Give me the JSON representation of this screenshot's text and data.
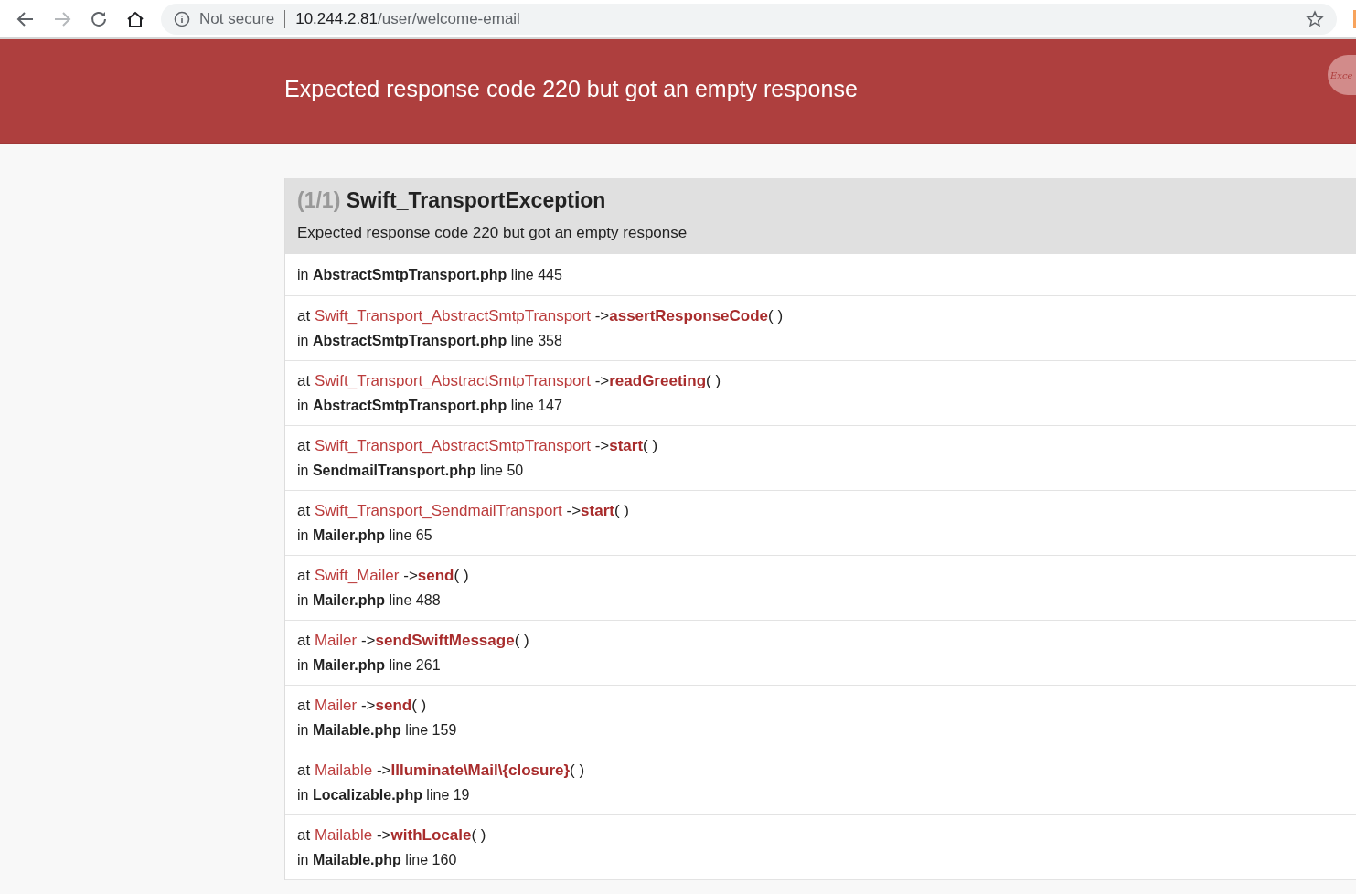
{
  "browser": {
    "security": "Not secure",
    "url_host": "10.244.2.81",
    "url_path": "/user/welcome-email"
  },
  "header": {
    "message": "Expected response code 220 but got an empty response",
    "badge": "Exce"
  },
  "exception": {
    "count": "(1/1)",
    "class": "Swift_TransportException",
    "message": "Expected response code 220 but got an empty response"
  },
  "trace": [
    {
      "location": "in **AbstractSmtpTransport.php** line 445"
    },
    {
      "at": "at",
      "class": "Swift_Transport_AbstractSmtpTransport",
      "arrow": "->",
      "method": "assertResponseCode",
      "parens": "( )",
      "location": "in **AbstractSmtpTransport.php** line 358"
    },
    {
      "at": "at",
      "class": "Swift_Transport_AbstractSmtpTransport",
      "arrow": "->",
      "method": "readGreeting",
      "parens": "( )",
      "location": "in **AbstractSmtpTransport.php** line 147"
    },
    {
      "at": "at",
      "class": "Swift_Transport_AbstractSmtpTransport",
      "arrow": "->",
      "method": "start",
      "parens": "( )",
      "location": "in **SendmailTransport.php** line 50"
    },
    {
      "at": "at",
      "class": "Swift_Transport_SendmailTransport",
      "arrow": "->",
      "method": "start",
      "parens": "( )",
      "location": "in **Mailer.php** line 65"
    },
    {
      "at": "at",
      "class": "Swift_Mailer",
      "arrow": "->",
      "method": "send",
      "parens": "( )",
      "location": "in **Mailer.php** line 488"
    },
    {
      "at": "at",
      "class": "Mailer",
      "arrow": "->",
      "method": "sendSwiftMessage",
      "parens": "( )",
      "location": "in **Mailer.php** line 261"
    },
    {
      "at": "at",
      "class": "Mailer",
      "arrow": "->",
      "method": "send",
      "parens": "( )",
      "location": "in **Mailable.php** line 159"
    },
    {
      "at": "at",
      "class": "Mailable",
      "arrow": "->",
      "method": "Illuminate\\Mail\\{closure}",
      "parens": "( )",
      "location": "in **Localizable.php** line 19"
    },
    {
      "at": "at",
      "class": "Mailable",
      "arrow": "->",
      "method": "withLocale",
      "parens": "( )",
      "location": "in **Mailable.php** line 160"
    }
  ]
}
